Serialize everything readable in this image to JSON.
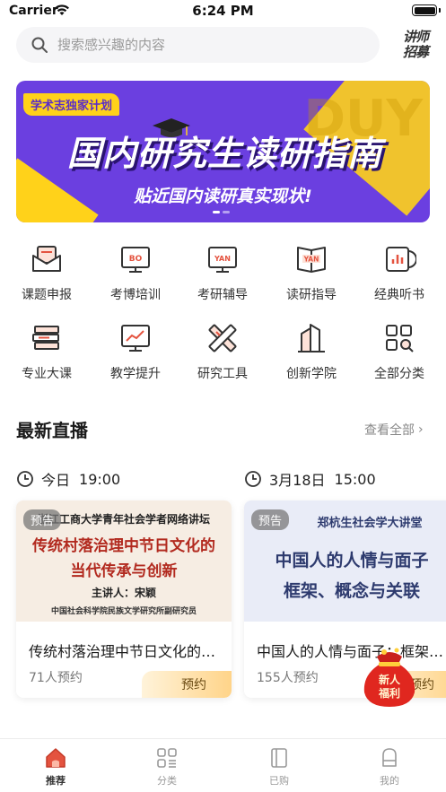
{
  "status_bar": {
    "carrier": "Carrier",
    "time": "6:24 PM"
  },
  "search": {
    "placeholder": "搜索感兴趣的内容",
    "recruit_link": "讲师\n招募"
  },
  "banner": {
    "tag": "学术志独家计划",
    "title": "国内研究生读研指南",
    "subtitle": "贴近国内读研真实现状!",
    "watermark": "DUY"
  },
  "categories": [
    {
      "label": "课题申报",
      "icon": "envelope-icon"
    },
    {
      "label": "考博培训",
      "icon": "bo-screen-icon"
    },
    {
      "label": "考研辅导",
      "icon": "yan-screen-icon"
    },
    {
      "label": "读研指导",
      "icon": "yan-book-icon"
    },
    {
      "label": "经典听书",
      "icon": "audio-book-icon"
    },
    {
      "label": "专业大课",
      "icon": "books-stack-icon"
    },
    {
      "label": "教学提升",
      "icon": "chart-board-icon"
    },
    {
      "label": "研究工具",
      "icon": "ruler-pencil-icon"
    },
    {
      "label": "创新学院",
      "icon": "buildings-icon"
    },
    {
      "label": "全部分类",
      "icon": "grid-search-icon"
    }
  ],
  "live_section": {
    "title": "最新直播",
    "view_all": "查看全部",
    "chevron": "›"
  },
  "live_cards": [
    {
      "day": "今日",
      "time": "19:00",
      "badge": "预告",
      "cover_top": "浙江工商大学青年社会学者网络讲坛",
      "cover_line1": "传统村落治理中节日文化的",
      "cover_line2": "当代传承与创新",
      "cover_speaker": "主讲人：宋颖",
      "cover_org": "中国社会科学院民族文学研究所副研究员",
      "title": "传统村落治理中节日文化的当代传承与创新",
      "count": "71人预约",
      "button": "预约"
    },
    {
      "day": "3月18日",
      "time": "15:00",
      "badge": "预告",
      "cover_top": "郑杭生社会学大讲堂",
      "cover_line1": "中国人的人情与面子",
      "cover_line2": "框架、概念与关联",
      "title": "中国人的人情与面子：框架、概念与关联",
      "count": "155人预约",
      "button": "预约"
    }
  ],
  "gift": {
    "line1": "新人",
    "line2": "福利"
  },
  "tab_bar": [
    {
      "label": "推荐",
      "icon": "home-icon",
      "active": true
    },
    {
      "label": "分类",
      "icon": "category-icon",
      "active": false
    },
    {
      "label": "已购",
      "icon": "purchased-icon",
      "active": false
    },
    {
      "label": "我的",
      "icon": "profile-icon",
      "active": false
    }
  ],
  "colors": {
    "accent": "#e4533f",
    "banner_purple": "#6b3fe0",
    "banner_yellow": "#ffd21a",
    "reserve_gold": "#ffd489"
  }
}
